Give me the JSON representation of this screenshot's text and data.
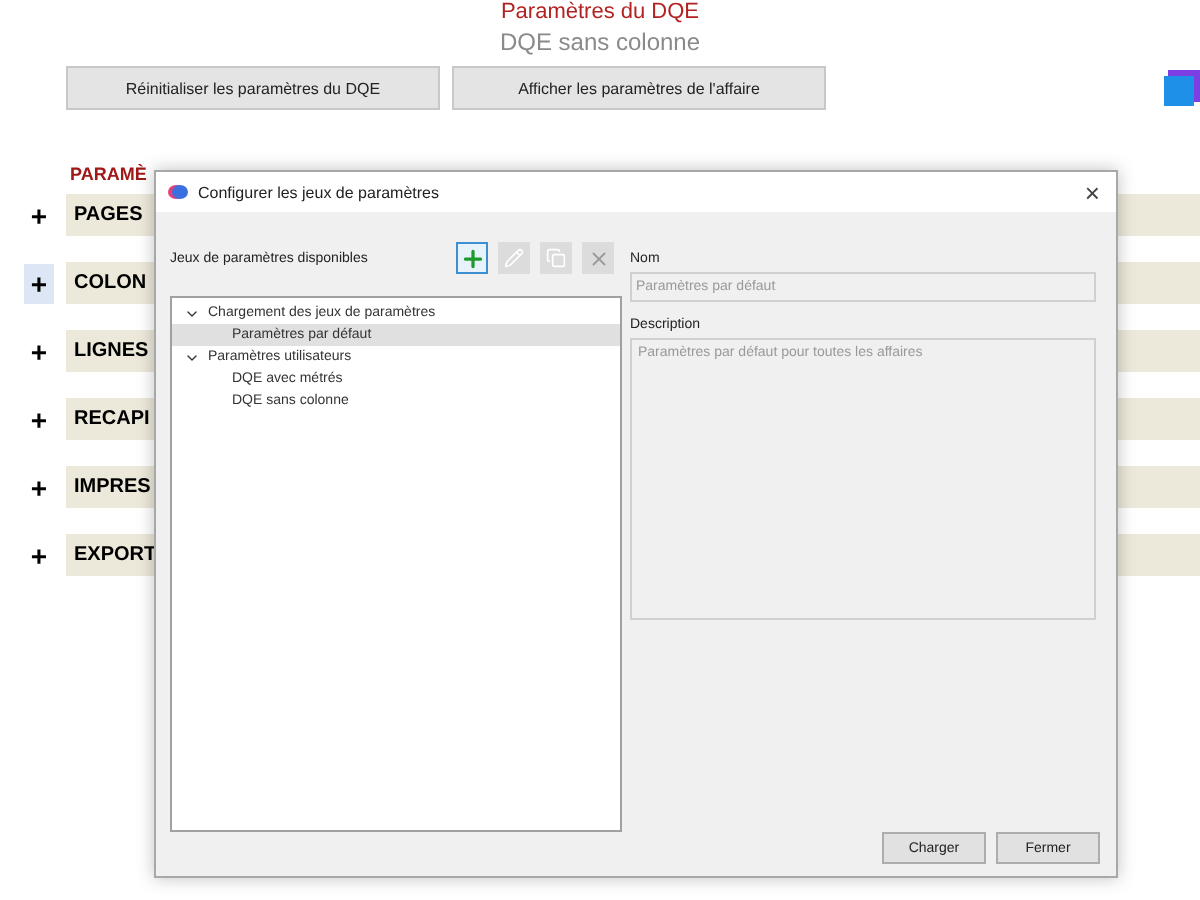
{
  "page": {
    "title": "Paramètres du DQE",
    "subtitle": "DQE sans colonne"
  },
  "actions": [
    "Réinitialiser les paramètres du DQE",
    "Afficher les paramètres de l'affaire"
  ],
  "section_heading": "PARAMÈ",
  "sections": [
    {
      "toggle": "+",
      "label": "PAGES",
      "selected": false
    },
    {
      "toggle": "+",
      "label": "COLON",
      "selected": true
    },
    {
      "toggle": "+",
      "label": "LIGNES",
      "selected": false
    },
    {
      "toggle": "+",
      "label": "RECAPI",
      "selected": false
    },
    {
      "toggle": "+",
      "label": "IMPRES",
      "selected": false
    },
    {
      "toggle": "+",
      "label": "EXPORT",
      "selected": false
    }
  ],
  "dialog": {
    "title": "Configurer les jeux de paramètres",
    "close": "×",
    "list_label": "Jeux de paramètres disponibles",
    "tools": [
      {
        "kind": "add",
        "disabled": false
      },
      {
        "kind": "edit",
        "disabled": true
      },
      {
        "kind": "copy",
        "disabled": true
      },
      {
        "kind": "delete",
        "disabled": true
      }
    ],
    "tree": [
      {
        "label": "Chargement des jeux de paramètres",
        "expanded": true,
        "selected": false,
        "children": [
          {
            "label": "Paramètres par défaut",
            "selected": true
          }
        ]
      },
      {
        "label": "Paramètres utilisateurs",
        "expanded": true,
        "selected": false,
        "children": [
          {
            "label": "DQE avec métrés",
            "selected": false
          },
          {
            "label": "DQE sans colonne",
            "selected": false
          }
        ]
      }
    ],
    "name_label": "Nom",
    "name_value": "Paramètres par défaut",
    "description_label": "Description",
    "description_value": "Paramètres par défaut pour toutes les affaires",
    "buttons": [
      "Charger",
      "Fermer"
    ]
  }
}
